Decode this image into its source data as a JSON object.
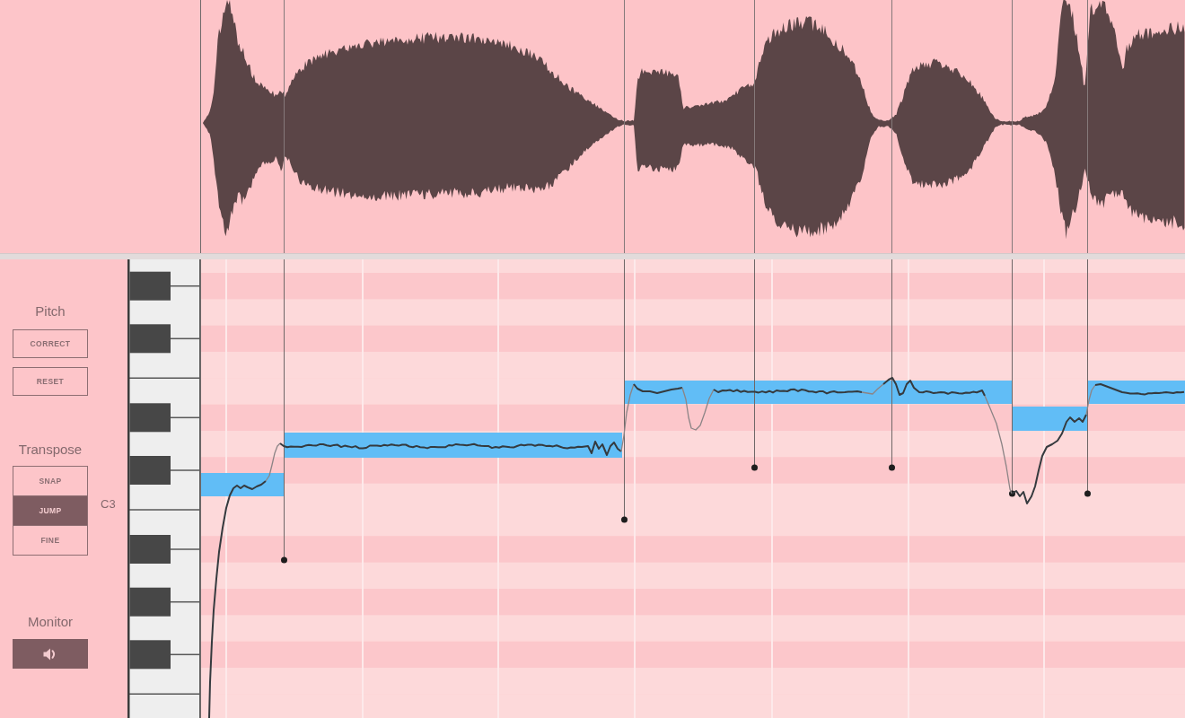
{
  "side_panel": {
    "pitch": {
      "title": "Pitch",
      "buttons": [
        "CORRECT",
        "RESET"
      ]
    },
    "transpose": {
      "title": "Transpose",
      "options": [
        {
          "label": "SNAP",
          "selected": false
        },
        {
          "label": "JUMP",
          "selected": true
        },
        {
          "label": "FINE",
          "selected": false
        }
      ]
    },
    "monitor": {
      "title": "Monitor",
      "on": true
    }
  },
  "keyboard": {
    "label": "C3"
  }
}
